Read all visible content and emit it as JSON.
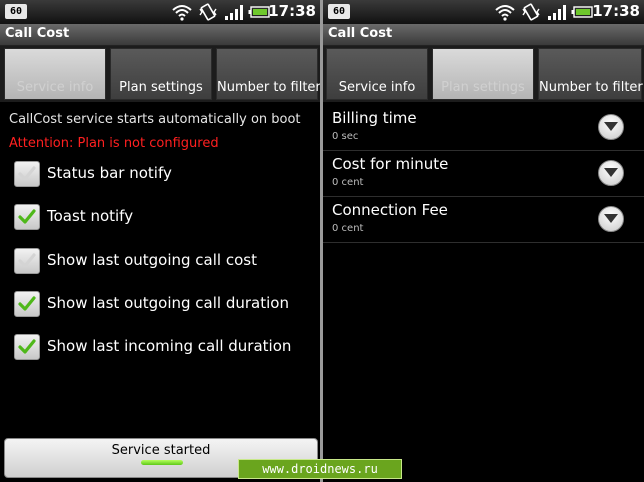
{
  "status_bar": {
    "badge": "60",
    "time": "17:38"
  },
  "app_title": "Call Cost",
  "tabs": [
    "Service info",
    "Plan settings",
    "Number to filter"
  ],
  "service_info": {
    "description": "CallCost service starts automatically on boot",
    "warning": "Attention: Plan is not configured",
    "warning_color": "#ff2020",
    "options": [
      {
        "label": "Status bar notify",
        "checked": false
      },
      {
        "label": "Toast notify",
        "checked": true
      },
      {
        "label": "Show last outgoing call cost",
        "checked": false
      },
      {
        "label": "Show last outgoing call duration",
        "checked": true
      },
      {
        "label": "Show last incoming call duration",
        "checked": true
      }
    ],
    "service_button": "Service started"
  },
  "plan_settings": [
    {
      "title": "Billing time",
      "value": "0 sec"
    },
    {
      "title": "Cost for minute",
      "value": "0 cent"
    },
    {
      "title": "Connection Fee",
      "value": "0 cent"
    }
  ],
  "watermark": "www.droidnews.ru"
}
